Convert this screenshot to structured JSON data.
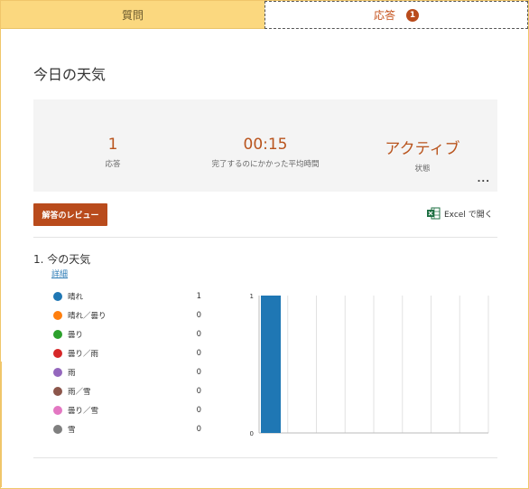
{
  "tabs": {
    "questions": "質問",
    "responses": "応答",
    "responses_badge": "1"
  },
  "page_title": "今日の天気",
  "stats": [
    {
      "value": "1",
      "label": "応答"
    },
    {
      "value": "00:15",
      "label": "完了するのにかかった平均時間"
    },
    {
      "value": "アクティブ",
      "label": "状態"
    }
  ],
  "more_label": "...",
  "review_button": "解答のレビュー",
  "excel_link": "Excel で開く",
  "question": {
    "title": "1.  今の天気",
    "details": "詳細"
  },
  "options": [
    {
      "name": "晴れ",
      "count": "1",
      "color": "#1f77b4"
    },
    {
      "name": "晴れ／曇り",
      "count": "0",
      "color": "#ff7f0e"
    },
    {
      "name": "曇り",
      "count": "0",
      "color": "#2ca02c"
    },
    {
      "name": "曇り／雨",
      "count": "0",
      "color": "#d62728"
    },
    {
      "name": "雨",
      "count": "0",
      "color": "#9467bd"
    },
    {
      "name": "雨／雪",
      "count": "0",
      "color": "#8c564b"
    },
    {
      "name": "曇り／雪",
      "count": "0",
      "color": "#e377c2"
    },
    {
      "name": "雪",
      "count": "0",
      "color": "#7f7f7f"
    }
  ],
  "chart_data": {
    "type": "bar",
    "categories": [
      "晴れ",
      "晴れ／曇り",
      "曇り",
      "曇り／雨",
      "雨",
      "雨／雪",
      "曇り／雪",
      "雪"
    ],
    "values": [
      1,
      0,
      0,
      0,
      0,
      0,
      0,
      0
    ],
    "ylim": [
      0,
      1
    ],
    "yticks": [
      "1",
      "0"
    ],
    "bar_color": "#1f77b4",
    "grid": true
  }
}
